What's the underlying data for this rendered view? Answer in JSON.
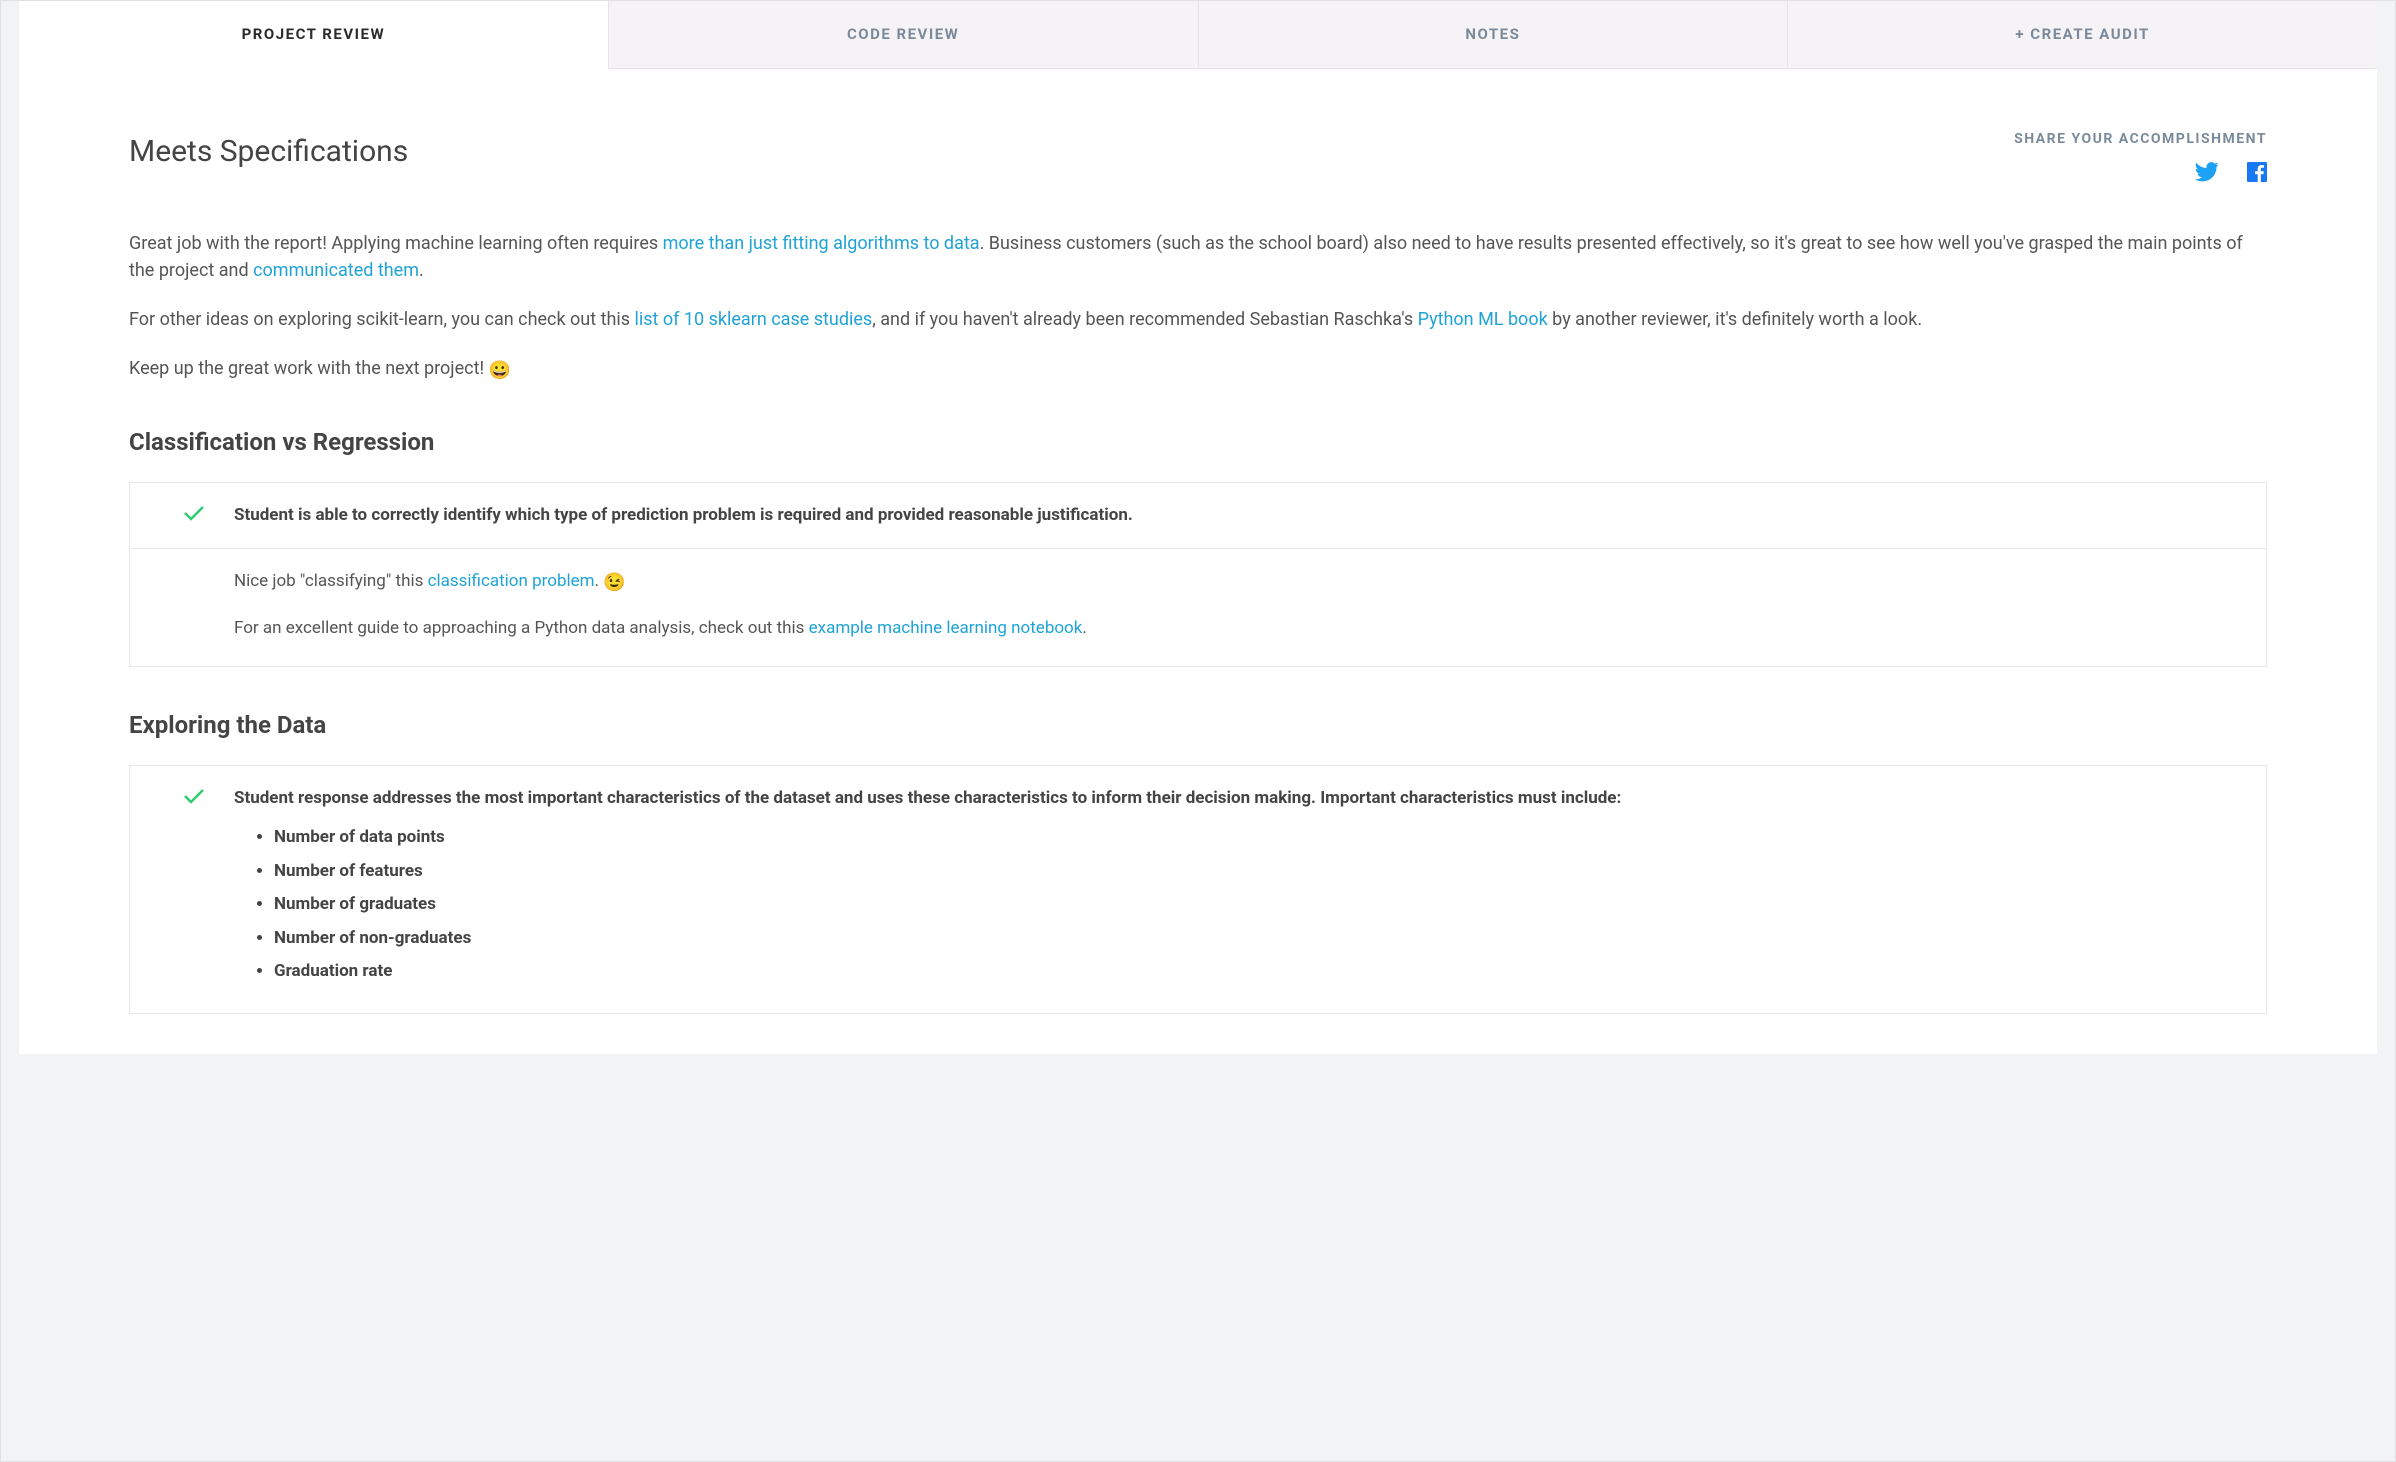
{
  "tabs": {
    "project_review": "PROJECT REVIEW",
    "code_review": "CODE REVIEW",
    "notes": "NOTES",
    "create_audit": "+ CREATE AUDIT"
  },
  "title": "Meets Specifications",
  "share": {
    "label": "SHARE YOUR ACCOMPLISHMENT"
  },
  "intro": {
    "p1a": "Great job with the report! Applying machine learning often requires ",
    "link1": "more than just fitting algorithms to data",
    "p1b": ". Business customers (such as the school board) also need to have results presented effectively, so it's great to see how well you've grasped the main points of the project and ",
    "link2": "communicated them",
    "p1c": ".",
    "p2a": "For other ideas on exploring scikit-learn, you can check out this ",
    "link3": "list of 10 sklearn case studies",
    "p2b": ", and if you haven't already been recommended Sebastian Raschka's ",
    "link4": "Python ML book",
    "p2c": " by another reviewer, it's definitely worth a look.",
    "p3": "Keep up the great work with the next project! ",
    "p3_emoji": "😀"
  },
  "section1": {
    "heading": "Classification vs Regression",
    "criteria": "Student is able to correctly identify which type of prediction problem is required and provided reasonable justification.",
    "body": {
      "p1a": "Nice job \"classifying\" this ",
      "link1": "classification problem",
      "p1b": ". ",
      "p1_emoji": "😉",
      "p2a": "For an excellent guide to approaching a Python data analysis, check out this ",
      "link2": "example machine learning notebook",
      "p2b": "."
    }
  },
  "section2": {
    "heading": "Exploring the Data",
    "criteria": "Student response addresses the most important characteristics of the dataset and uses these characteristics to inform their decision making. Important characteristics must include:",
    "bullets": {
      "b1": "Number of data points",
      "b2": "Number of features",
      "b3": "Number of graduates",
      "b4": "Number of non-graduates",
      "b5": "Graduation rate"
    }
  }
}
